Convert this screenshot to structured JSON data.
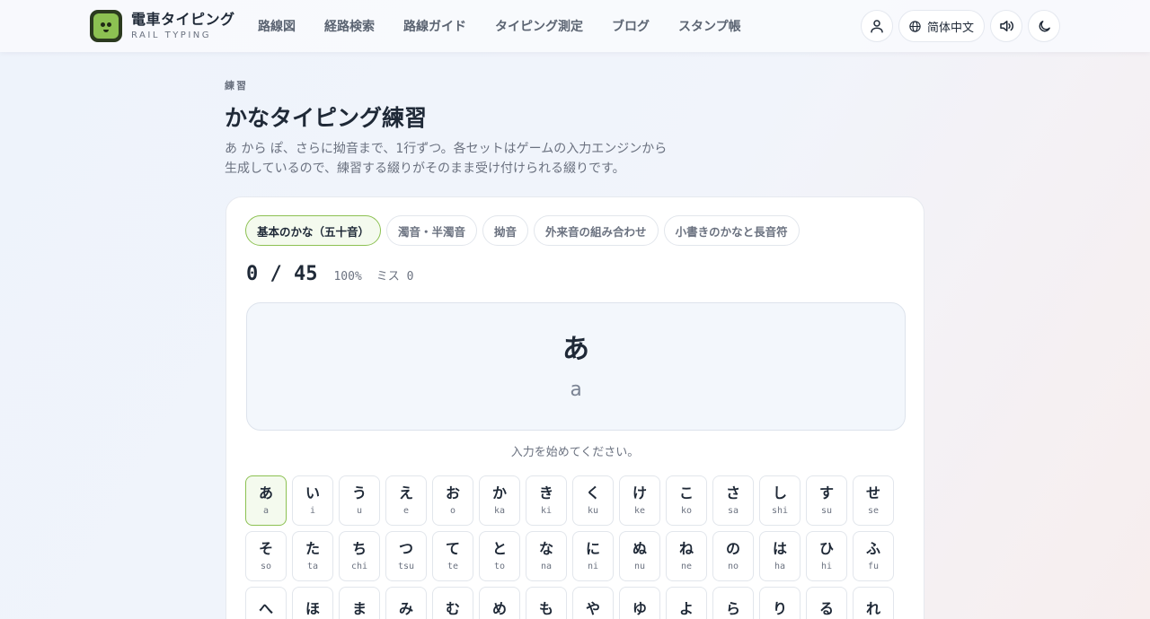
{
  "brand": {
    "title": "電車タイピング",
    "subtitle": "RAIL TYPING"
  },
  "nav": [
    "路線図",
    "経路検索",
    "路線ガイド",
    "タイピング測定",
    "ブログ",
    "スタンプ帳"
  ],
  "tools": {
    "user_icon": "user-icon",
    "language_icon": "globe-icon",
    "language": "简体中文",
    "sound_icon": "speaker-icon",
    "theme_icon": "moon-icon"
  },
  "intro": {
    "eyebrow": "練習",
    "title": "かなタイピング練習",
    "description": "あ から ぽ、さらに拗音まで、1行ずつ。各セットはゲームの入力エンジンから生成しているので、練習する綴りがそのまま受け付けられる綴りです。"
  },
  "tabs": [
    {
      "label": "基本のかな（五十音）",
      "active": true
    },
    {
      "label": "濁音・半濁音",
      "active": false
    },
    {
      "label": "拗音",
      "active": false
    },
    {
      "label": "外来音の組み合わせ",
      "active": false
    },
    {
      "label": "小書きのかなと長音符",
      "active": false
    }
  ],
  "progress": {
    "count": "0 / 45",
    "accuracy": "100%",
    "misses": "ミス 0"
  },
  "prompt": {
    "kana": "あ",
    "romaji": "a"
  },
  "hint": "入力を始めてください。",
  "keys": [
    {
      "kana": "あ",
      "romaji": "a"
    },
    {
      "kana": "い",
      "romaji": "i"
    },
    {
      "kana": "う",
      "romaji": "u"
    },
    {
      "kana": "え",
      "romaji": "e"
    },
    {
      "kana": "お",
      "romaji": "o"
    },
    {
      "kana": "か",
      "romaji": "ka"
    },
    {
      "kana": "き",
      "romaji": "ki"
    },
    {
      "kana": "く",
      "romaji": "ku"
    },
    {
      "kana": "け",
      "romaji": "ke"
    },
    {
      "kana": "こ",
      "romaji": "ko"
    },
    {
      "kana": "さ",
      "romaji": "sa"
    },
    {
      "kana": "し",
      "romaji": "shi"
    },
    {
      "kana": "す",
      "romaji": "su"
    },
    {
      "kana": "せ",
      "romaji": "se"
    },
    {
      "kana": "そ",
      "romaji": "so"
    },
    {
      "kana": "た",
      "romaji": "ta"
    },
    {
      "kana": "ち",
      "romaji": "chi"
    },
    {
      "kana": "つ",
      "romaji": "tsu"
    },
    {
      "kana": "て",
      "romaji": "te"
    },
    {
      "kana": "と",
      "romaji": "to"
    },
    {
      "kana": "な",
      "romaji": "na"
    },
    {
      "kana": "に",
      "romaji": "ni"
    },
    {
      "kana": "ぬ",
      "romaji": "nu"
    },
    {
      "kana": "ね",
      "romaji": "ne"
    },
    {
      "kana": "の",
      "romaji": "no"
    },
    {
      "kana": "は",
      "romaji": "ha"
    },
    {
      "kana": "ひ",
      "romaji": "hi"
    },
    {
      "kana": "ふ",
      "romaji": "fu"
    },
    {
      "kana": "へ",
      "romaji": ""
    },
    {
      "kana": "ほ",
      "romaji": ""
    },
    {
      "kana": "ま",
      "romaji": ""
    },
    {
      "kana": "み",
      "romaji": ""
    },
    {
      "kana": "む",
      "romaji": ""
    },
    {
      "kana": "め",
      "romaji": ""
    },
    {
      "kana": "も",
      "romaji": ""
    },
    {
      "kana": "や",
      "romaji": ""
    },
    {
      "kana": "ゆ",
      "romaji": ""
    },
    {
      "kana": "よ",
      "romaji": ""
    },
    {
      "kana": "ら",
      "romaji": ""
    },
    {
      "kana": "り",
      "romaji": ""
    },
    {
      "kana": "る",
      "romaji": ""
    },
    {
      "kana": "れ",
      "romaji": ""
    }
  ],
  "colors": {
    "accent": "#8cc152",
    "text": "#1f2937",
    "muted": "#6b7280"
  }
}
